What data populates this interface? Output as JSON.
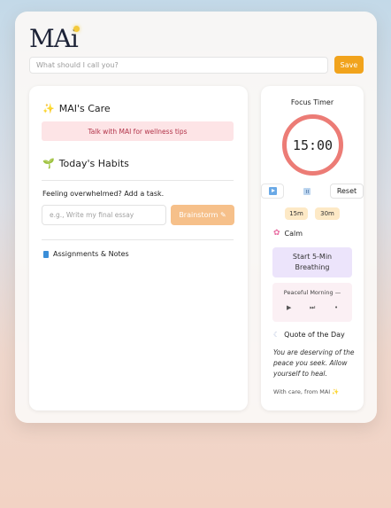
{
  "app": {
    "logo": "MAi",
    "name_placeholder": "What should I call you?",
    "save_label": "Save"
  },
  "care": {
    "icon": "sparkles-icon",
    "title": "MAI's Care",
    "banner": "Talk with MAI for wellness tips"
  },
  "habits": {
    "icon": "seedling-icon",
    "title": "Today's Habits",
    "prompt": "Feeling overwhelmed? Add a task.",
    "task_placeholder": "e.g., Write my final essay",
    "brainstorm_label": "Brainstorm ✎"
  },
  "assignments": {
    "icon": "book-icon",
    "label": "Assignments & Notes"
  },
  "focus": {
    "title": "Focus Timer",
    "time": "15:00",
    "reset_label": "Reset",
    "presets": [
      "15m",
      "30m"
    ],
    "ring_color": "#ec7c76"
  },
  "calm": {
    "icon": "flower-icon",
    "title": "Calm",
    "breathing_label": "Start 5-Min Breathing",
    "player_title": "Peaceful Morning —",
    "player_controls": [
      "▶",
      "⏭",
      "•"
    ]
  },
  "quote": {
    "icon": "moon-icon",
    "title": "Quote of the Day",
    "text": "You are deserving of the peace you seek. Allow yourself to heal.",
    "signoff": "With care, from MAI ✨"
  },
  "colors": {
    "accent": "#f1a31c",
    "banner_bg": "#fde4e6",
    "banner_text": "#b2344a",
    "brainstorm_bg": "#f6c08a",
    "breathing_bg": "#ece4fb"
  }
}
